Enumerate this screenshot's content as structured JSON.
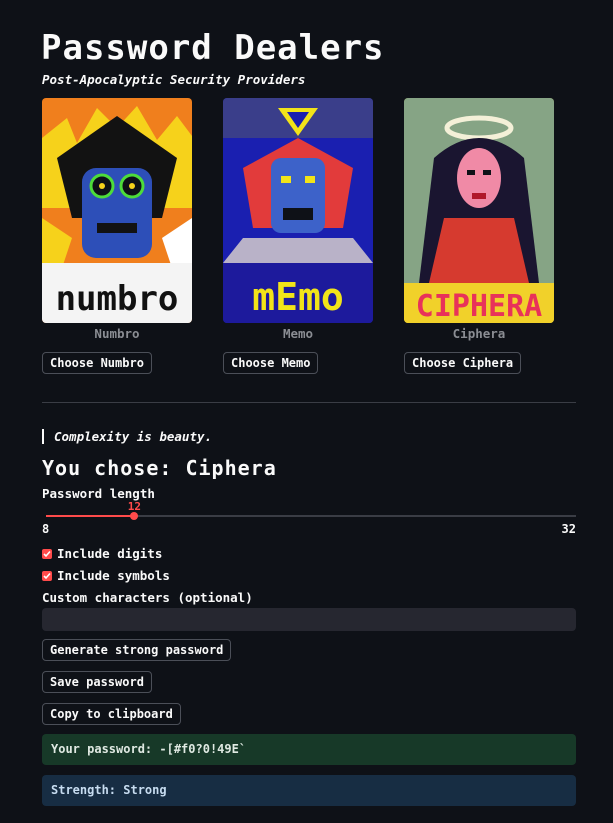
{
  "header": {
    "title": "Password Dealers",
    "subtitle": "Post-Apocalyptic Security Providers"
  },
  "dealers": [
    {
      "name": "Numbro",
      "button": "Choose Numbro",
      "card_text": "numbro",
      "bg": "#f07f1d"
    },
    {
      "name": "Memo",
      "button": "Choose Memo",
      "card_text": "mEmo",
      "bg": "#1a1fb0"
    },
    {
      "name": "Ciphera",
      "button": "Choose Ciphera",
      "card_text": "CIPHERA",
      "bg": "#f1d12a"
    }
  ],
  "quote": "Complexity is beauty.",
  "selection": "You chose: Ciphera",
  "length": {
    "label": "Password length",
    "min": 8,
    "max": 32,
    "value": 12,
    "min_label": "8",
    "max_label": "32",
    "value_label": "12"
  },
  "options": {
    "digits": "Include digits",
    "symbols": "Include symbols"
  },
  "custom": {
    "label": "Custom characters (optional)",
    "value": ""
  },
  "buttons": {
    "generate": "Generate strong password",
    "save": "Save password",
    "copy": "Copy to clipboard"
  },
  "result": {
    "password": "Your password: -[#f0?0!49E`",
    "strength": "Strength: Strong"
  },
  "colors": {
    "accent": "#ff4b4b",
    "background": "#0e1117",
    "success_bg": "#173928",
    "info_bg": "#172d43"
  }
}
